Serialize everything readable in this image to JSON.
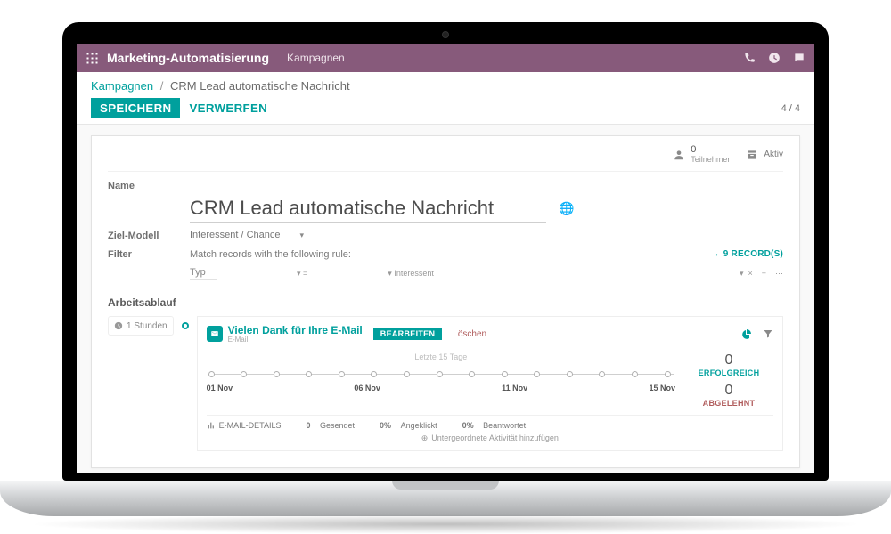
{
  "topbar": {
    "app_title": "Marketing-Automatisierung",
    "menu": "Kampagnen"
  },
  "breadcrumb": {
    "root": "Kampagnen",
    "current": "CRM Lead automatische Nachricht"
  },
  "buttons": {
    "save": "SPEICHERN",
    "discard": "VERWERFEN"
  },
  "pager": "4 / 4",
  "stats": {
    "participants_count": "0",
    "participants_label": "Teilnehmer",
    "active_label": "Aktiv"
  },
  "form": {
    "name_label": "Name",
    "name_value": "CRM Lead automatische Nachricht",
    "target_label": "Ziel-Modell",
    "target_value": "Interessent / Chance",
    "filter_label": "Filter",
    "filter_hint": "Match records with the following rule:",
    "records_link": "9 RECORD(S)",
    "filter_field_type": "Typ",
    "filter_value": "Interessent"
  },
  "workflow": {
    "heading": "Arbeitsablauf",
    "delay": "1 Stunden",
    "activity": {
      "title": "Vielen Dank für Ihre E-Mail",
      "type": "E-Mail",
      "edit": "BEARBEITEN",
      "delete": "Löschen",
      "chart_caption": "Letzte 15 Tage",
      "x_labels": [
        "01 Nov",
        "06 Nov",
        "11 Nov",
        "15 Nov"
      ],
      "kpi_success_n": "0",
      "kpi_success_l": "ERFOLGREICH",
      "kpi_reject_n": "0",
      "kpi_reject_l": "ABGELEHNT",
      "foot_details": "E-MAIL-DETAILS",
      "foot_sent_n": "0",
      "foot_sent_l": "Gesendet",
      "foot_click_n": "0%",
      "foot_click_l": "Angeklickt",
      "foot_reply_n": "0%",
      "foot_reply_l": "Beantwortet",
      "add_child": "Untergeordnete Aktivität hinzufügen"
    }
  },
  "chart_data": {
    "type": "line",
    "title": "Letzte 15 Tage",
    "x": [
      "01 Nov",
      "02 Nov",
      "03 Nov",
      "04 Nov",
      "05 Nov",
      "06 Nov",
      "07 Nov",
      "08 Nov",
      "09 Nov",
      "10 Nov",
      "11 Nov",
      "12 Nov",
      "13 Nov",
      "14 Nov",
      "15 Nov"
    ],
    "series": [
      {
        "name": "Gesendet",
        "values": [
          0,
          0,
          0,
          0,
          0,
          0,
          0,
          0,
          0,
          0,
          0,
          0,
          0,
          0,
          0
        ]
      }
    ],
    "xlabel": "",
    "ylabel": "",
    "ylim": [
      0,
      1
    ]
  }
}
